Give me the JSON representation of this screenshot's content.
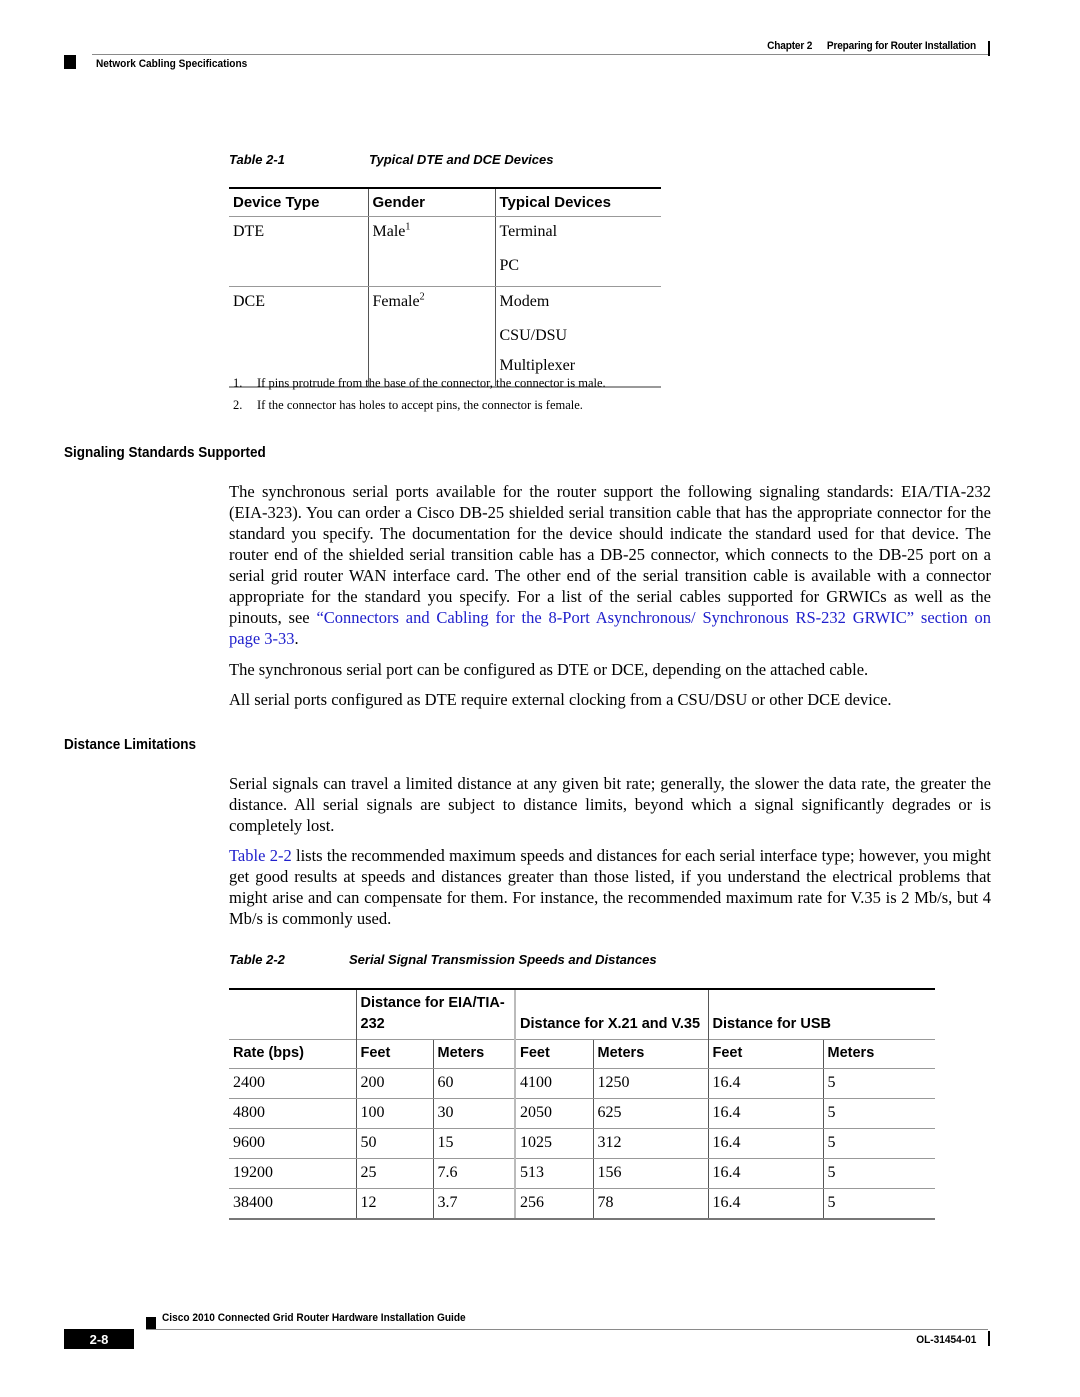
{
  "header": {
    "chapter": "Chapter 2",
    "chapter_title": "Preparing for Router Installation",
    "section": "Network Cabling Specifications"
  },
  "table1": {
    "number": "Table 2-1",
    "title": "Typical DTE and DCE Devices",
    "columns": [
      "Device Type",
      "Gender",
      "Typical Devices"
    ],
    "rows": [
      {
        "device_type": "DTE",
        "gender": "Male",
        "footnote": "1",
        "devices": [
          "Terminal",
          "PC"
        ]
      },
      {
        "device_type": "DCE",
        "gender": "Female",
        "footnote": "2",
        "devices": [
          "Modem",
          "CSU/DSU",
          "Multiplexer"
        ]
      }
    ],
    "footnotes": [
      {
        "n": "1.",
        "text": "If pins protrude from the base of the connector, the connector is male."
      },
      {
        "n": "2.",
        "text": "If the connector has holes to accept pins, the connector is female."
      }
    ]
  },
  "signaling": {
    "heading": "Signaling Standards Supported",
    "para1_text": "The synchronous serial ports available for the router support the following signaling standards: EIA/TIA-232 (EIA-323). You can order a Cisco DB-25 shielded serial transition cable that has the appropriate connector for the standard you specify. The documentation for the device should indicate the standard used for that device. The router end of the shielded serial transition cable has a DB-25 connector, which connects to the DB-25 port on a serial grid router WAN interface card. The other end of the serial transition cable is available with a connector appropriate for the standard you specify. For a list of the serial cables supported for GRWICs as well as the pinouts, see ",
    "para1_link": "“Connectors and Cabling for the 8-Port Asynchronous/ Synchronous RS-232 GRWIC” section on page 3-33",
    "para1_end": ".",
    "para2": "The synchronous serial port can be configured as DTE or DCE, depending on the attached cable.",
    "para3": "All serial ports configured as DTE require external clocking from a CSU/DSU or other DCE device."
  },
  "distance": {
    "heading": "Distance Limitations",
    "para1": "Serial signals can travel a limited distance at any given bit rate; generally, the slower the data rate, the greater the distance. All serial signals are subject to distance limits, beyond which a signal significantly degrades or is completely lost.",
    "para2_link": "Table 2-2",
    "para2_text": " lists the recommended maximum speeds and distances for each serial interface type; however, you might get good results at speeds and distances greater than those listed, if you understand the electrical problems that might arise and can compensate for them. For instance, the recommended maximum rate for V.35 is 2 Mb/s, but 4 Mb/s is commonly used."
  },
  "table2": {
    "number": "Table 2-2",
    "title": "Serial Signal Transmission Speeds and Distances",
    "group_headers": [
      "Distance for EIA/TIA-232",
      "Distance for X.21 and V.35",
      "Distance for USB"
    ],
    "sub_headers": [
      "Rate (bps)",
      "Feet",
      "Meters",
      "Feet",
      "Meters",
      "Feet",
      "Meters"
    ],
    "rows": [
      [
        "2400",
        "200",
        "60",
        "4100",
        "1250",
        "16.4",
        "5"
      ],
      [
        "4800",
        "100",
        "30",
        "2050",
        "625",
        "16.4",
        "5"
      ],
      [
        "9600",
        "50",
        "15",
        "1025",
        "312",
        "16.4",
        "5"
      ],
      [
        "19200",
        "25",
        "7.6",
        "513",
        "156",
        "16.4",
        "5"
      ],
      [
        "38400",
        "12",
        "3.7",
        "256",
        "78",
        "16.4",
        "5"
      ]
    ]
  },
  "footer": {
    "guide_title": "Cisco 2010 Connected Grid Router Hardware Installation Guide",
    "page_number": "2-8",
    "doc_number": "OL-31454-01"
  },
  "colors": {
    "link": "#2020cc"
  }
}
